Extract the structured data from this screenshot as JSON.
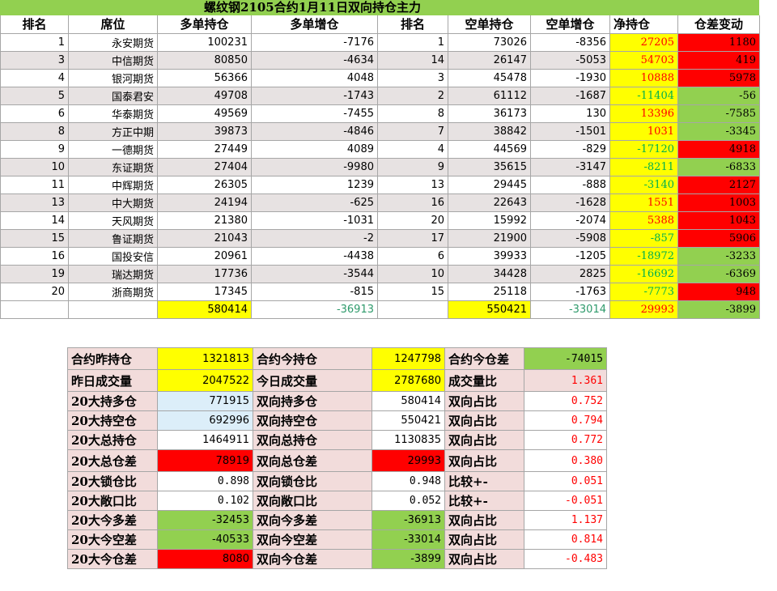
{
  "title": "螺纹钢2105合约1月11日双向持仓主力",
  "headers": [
    "排名",
    "席位",
    "多单持仓",
    "多单增仓",
    "排名",
    "空单持仓",
    "空单增仓",
    "净持仓",
    "仓差变动"
  ],
  "rows": [
    {
      "rank": "1",
      "seat": "永安期货",
      "long": "100231",
      "long_chg": "-7176",
      "srank": "1",
      "short": "73026",
      "short_chg": "-8356",
      "net": "27205",
      "diff": "1180"
    },
    {
      "rank": "3",
      "seat": "中信期货",
      "long": "80850",
      "long_chg": "-4634",
      "srank": "14",
      "short": "26147",
      "short_chg": "-5053",
      "net": "54703",
      "diff": "419"
    },
    {
      "rank": "4",
      "seat": "银河期货",
      "long": "56366",
      "long_chg": "4048",
      "srank": "3",
      "short": "45478",
      "short_chg": "-1930",
      "net": "10888",
      "diff": "5978"
    },
    {
      "rank": "5",
      "seat": "国泰君安",
      "long": "49708",
      "long_chg": "-1743",
      "srank": "2",
      "short": "61112",
      "short_chg": "-1687",
      "net": "-11404",
      "diff": "-56"
    },
    {
      "rank": "6",
      "seat": "华泰期货",
      "long": "49569",
      "long_chg": "-7455",
      "srank": "8",
      "short": "36173",
      "short_chg": "130",
      "net": "13396",
      "diff": "-7585"
    },
    {
      "rank": "8",
      "seat": "方正中期",
      "long": "39873",
      "long_chg": "-4846",
      "srank": "7",
      "short": "38842",
      "short_chg": "-1501",
      "net": "1031",
      "diff": "-3345"
    },
    {
      "rank": "9",
      "seat": "一德期货",
      "long": "27449",
      "long_chg": "4089",
      "srank": "4",
      "short": "44569",
      "short_chg": "-829",
      "net": "-17120",
      "diff": "4918"
    },
    {
      "rank": "10",
      "seat": "东证期货",
      "long": "27404",
      "long_chg": "-9980",
      "srank": "9",
      "short": "35615",
      "short_chg": "-3147",
      "net": "-8211",
      "diff": "-6833"
    },
    {
      "rank": "11",
      "seat": "中辉期货",
      "long": "26305",
      "long_chg": "1239",
      "srank": "13",
      "short": "29445",
      "short_chg": "-888",
      "net": "-3140",
      "diff": "2127"
    },
    {
      "rank": "13",
      "seat": "中大期货",
      "long": "24194",
      "long_chg": "-625",
      "srank": "16",
      "short": "22643",
      "short_chg": "-1628",
      "net": "1551",
      "diff": "1003"
    },
    {
      "rank": "14",
      "seat": "天风期货",
      "long": "21380",
      "long_chg": "-1031",
      "srank": "20",
      "short": "15992",
      "short_chg": "-2074",
      "net": "5388",
      "diff": "1043"
    },
    {
      "rank": "15",
      "seat": "鲁证期货",
      "long": "21043",
      "long_chg": "-2",
      "srank": "17",
      "short": "21900",
      "short_chg": "-5908",
      "net": "-857",
      "diff": "5906"
    },
    {
      "rank": "16",
      "seat": "国投安信",
      "long": "20961",
      "long_chg": "-4438",
      "srank": "6",
      "short": "39933",
      "short_chg": "-1205",
      "net": "-18972",
      "diff": "-3233"
    },
    {
      "rank": "19",
      "seat": "瑞达期货",
      "long": "17736",
      "long_chg": "-3544",
      "srank": "10",
      "short": "34428",
      "short_chg": "2825",
      "net": "-16692",
      "diff": "-6369"
    },
    {
      "rank": "20",
      "seat": "浙商期货",
      "long": "17345",
      "long_chg": "-815",
      "srank": "15",
      "short": "25118",
      "short_chg": "-1763",
      "net": "-7773",
      "diff": "948"
    }
  ],
  "totals": {
    "long": "580414",
    "long_chg": "-36913",
    "short": "550421",
    "short_chg": "-33014",
    "net": "29993",
    "diff": "-3899"
  },
  "summary": [
    {
      "l1": "合约昨持仓",
      "v1": "1321813",
      "l2": "合约今持仓",
      "v2": "1247798",
      "l3": "合约今仓差",
      "v3": "-74015"
    },
    {
      "l1": "昨日成交量",
      "v1": "2047522",
      "l2": "今日成交量",
      "v2": "2787680",
      "l3": "成交量比",
      "v3": "1.361"
    },
    {
      "l1": "20大持多仓",
      "v1": "771915",
      "l2": "双向持多仓",
      "v2": "580414",
      "l3": "双向占比",
      "v3": "0.752"
    },
    {
      "l1": "20大持空仓",
      "v1": "692996",
      "l2": "双向持空仓",
      "v2": "550421",
      "l3": "双向占比",
      "v3": "0.794"
    },
    {
      "l1": "20大总持仓",
      "v1": "1464911",
      "l2": "双向总持仓",
      "v2": "1130835",
      "l3": "双向占比",
      "v3": "0.772"
    },
    {
      "l1": "20大总仓差",
      "v1": "78919",
      "l2": "双向总仓差",
      "v2": "29993",
      "l3": "双向占比",
      "v3": "0.380"
    },
    {
      "l1": "20大锁仓比",
      "v1": "0.898",
      "l2": "双向锁仓比",
      "v2": "0.948",
      "l3": "比较+-",
      "v3": "0.051"
    },
    {
      "l1": "20大敞口比",
      "v1": "0.102",
      "l2": "双向敞口比",
      "v2": "0.052",
      "l3": "比较+-",
      "v3": "-0.051"
    },
    {
      "l1": "20大今多差",
      "v1": "-32453",
      "l2": "双向今多差",
      "v2": "-36913",
      "l3": "双向占比",
      "v3": "1.137"
    },
    {
      "l1": "20大今空差",
      "v1": "-40533",
      "l2": "双向今空差",
      "v2": "-33014",
      "l3": "双向占比",
      "v3": "0.814"
    },
    {
      "l1": "20大今仓差",
      "v1": "8080",
      "l2": "双向今仓差",
      "v2": "-3899",
      "l3": "双向占比",
      "v3": "-0.483"
    }
  ]
}
